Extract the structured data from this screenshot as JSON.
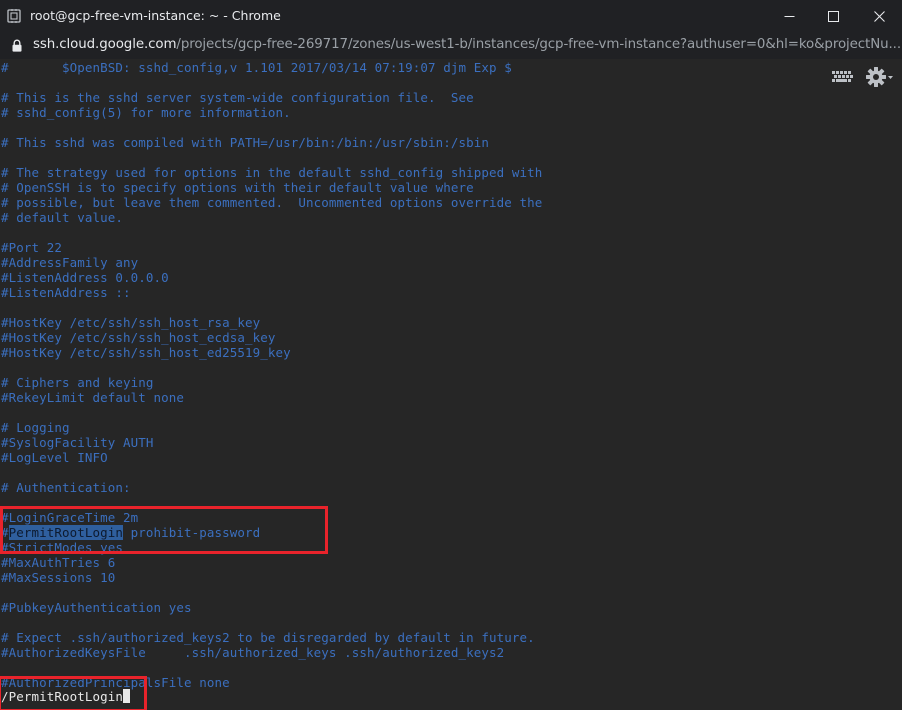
{
  "window": {
    "title": "root@gcp-free-vm-instance: ~ - Chrome"
  },
  "address": {
    "host": "ssh.cloud.google.com",
    "path": "/projects/gcp-free-269717/zones/us-west1-b/instances/gcp-free-vm-instance?authuser=0&hl=ko&projectNu..."
  },
  "toolbar": {
    "icons": [
      "keyboard-icon",
      "gear-icon"
    ]
  },
  "terminal": {
    "lines": [
      "#       $OpenBSD: sshd_config,v 1.101 2017/03/14 07:19:07 djm Exp $",
      "",
      "# This is the sshd server system-wide configuration file.  See",
      "# sshd_config(5) for more information.",
      "",
      "# This sshd was compiled with PATH=/usr/bin:/bin:/usr/sbin:/sbin",
      "",
      "# The strategy used for options in the default sshd_config shipped with",
      "# OpenSSH is to specify options with their default value where",
      "# possible, but leave them commented.  Uncommented options override the",
      "# default value.",
      "",
      "#Port 22",
      "#AddressFamily any",
      "#ListenAddress 0.0.0.0",
      "#ListenAddress ::",
      "",
      "#HostKey /etc/ssh/ssh_host_rsa_key",
      "#HostKey /etc/ssh/ssh_host_ecdsa_key",
      "#HostKey /etc/ssh/ssh_host_ed25519_key",
      "",
      "# Ciphers and keying",
      "#RekeyLimit default none",
      "",
      "# Logging",
      "#SyslogFacility AUTH",
      "#LogLevel INFO",
      "",
      "# Authentication:",
      "",
      "#LoginGraceTime 2m",
      "#PermitRootLogin prohibit-password",
      "#StrictModes yes",
      "#MaxAuthTries 6",
      "#MaxSessions 10",
      "",
      "#PubkeyAuthentication yes",
      "",
      "# Expect .ssh/authorized_keys2 to be disregarded by default in future.",
      "#AuthorizedKeysFile     .ssh/authorized_keys .ssh/authorized_keys2",
      "",
      "#AuthorizedPrincipalsFile none"
    ],
    "highlight": {
      "line_index": 31,
      "text": "PermitRootLogin"
    },
    "command": "/PermitRootLogin"
  },
  "colors": {
    "comment_text": "#3b6fbf",
    "terminal_bg": "#262626",
    "selection": "#2f5f9e",
    "annotation_red": "#e8232b"
  }
}
